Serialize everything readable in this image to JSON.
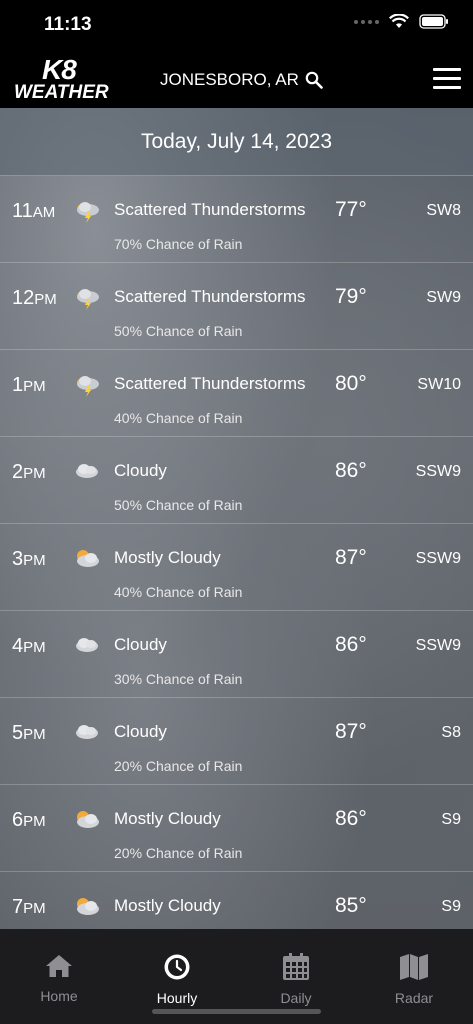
{
  "status": {
    "time": "11:13"
  },
  "header": {
    "logo_top": "K8",
    "logo_bottom": "WEATHER",
    "location": "JONESBORO, AR"
  },
  "date_title": "Today, July 14, 2023",
  "hours": [
    {
      "hour": "11",
      "ampm": "AM",
      "icon": "thunderstorm-icon",
      "condition": "Scattered Thunderstorms",
      "rain": "70% Chance of Rain",
      "temp": "77°",
      "wind": "SW8"
    },
    {
      "hour": "12",
      "ampm": "PM",
      "icon": "thunderstorm-icon",
      "condition": "Scattered Thunderstorms",
      "rain": "50% Chance of Rain",
      "temp": "79°",
      "wind": "SW9"
    },
    {
      "hour": "1",
      "ampm": "PM",
      "icon": "thunderstorm-icon",
      "condition": "Scattered Thunderstorms",
      "rain": "40% Chance of Rain",
      "temp": "80°",
      "wind": "SW10"
    },
    {
      "hour": "2",
      "ampm": "PM",
      "icon": "cloud-icon",
      "condition": "Cloudy",
      "rain": "50% Chance of Rain",
      "temp": "86°",
      "wind": "SSW9"
    },
    {
      "hour": "3",
      "ampm": "PM",
      "icon": "mostly-cloudy-icon",
      "condition": "Mostly Cloudy",
      "rain": "40% Chance of Rain",
      "temp": "87°",
      "wind": "SSW9"
    },
    {
      "hour": "4",
      "ampm": "PM",
      "icon": "cloud-icon",
      "condition": "Cloudy",
      "rain": "30% Chance of Rain",
      "temp": "86°",
      "wind": "SSW9"
    },
    {
      "hour": "5",
      "ampm": "PM",
      "icon": "cloud-icon",
      "condition": "Cloudy",
      "rain": "20% Chance of Rain",
      "temp": "87°",
      "wind": "S8"
    },
    {
      "hour": "6",
      "ampm": "PM",
      "icon": "mostly-cloudy-icon",
      "condition": "Mostly Cloudy",
      "rain": "20% Chance of Rain",
      "temp": "86°",
      "wind": "S9"
    },
    {
      "hour": "7",
      "ampm": "PM",
      "icon": "mostly-cloudy-icon",
      "condition": "Mostly Cloudy",
      "rain": "",
      "temp": "85°",
      "wind": "S9"
    }
  ],
  "tabs": [
    {
      "label": "Home",
      "icon": "home-icon",
      "active": false
    },
    {
      "label": "Hourly",
      "icon": "clock-icon",
      "active": true
    },
    {
      "label": "Daily",
      "icon": "calendar-icon",
      "active": false
    },
    {
      "label": "Radar",
      "icon": "map-icon",
      "active": false
    }
  ]
}
